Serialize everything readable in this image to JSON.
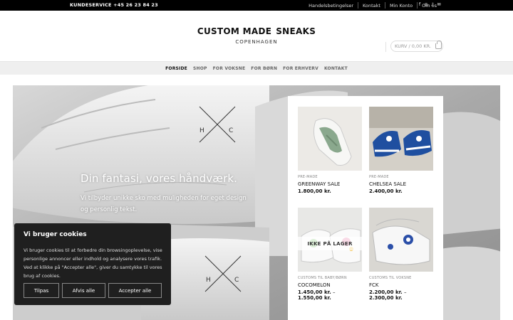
{
  "topbar": {
    "customer_service": "KUNDESERVICE +45 26 23 84 23",
    "links": [
      "Handelsbetingelser",
      "Kontakt",
      "Min Konto",
      "Om os"
    ],
    "socials": [
      "facebook-icon",
      "instagram-icon",
      "tiktok-icon",
      "email-icon"
    ]
  },
  "logo": {
    "line1_left": "CUSTOM MADE",
    "line1_right": "SNEAKS",
    "line2": "COPENHAGEN"
  },
  "cart": {
    "label": "KURV / 0,00 KR."
  },
  "nav": {
    "items": [
      "FORSIDE",
      "SHOP",
      "FOR VOKSNE",
      "FOR BØRN",
      "FOR ERHVERV",
      "KONTAKT"
    ],
    "active": "FORSIDE"
  },
  "hero": {
    "title": "Din fantasi, vores håndværk.",
    "text": "Vi tilbyder unikke sko med muligheden for eget design og personlig tekst."
  },
  "products": [
    {
      "category": "PRE-MADE",
      "name": "GREENWAY SALE",
      "price": "1.800,00 kr."
    },
    {
      "category": "PRE-MADE",
      "name": "CHELSEA SALE",
      "price": "2.400,00 kr."
    },
    {
      "category": "CUSTOMS TIL BABY/BØRN",
      "name": "COCOMELON",
      "price_from": "1.450,00 kr.",
      "price_to": "1.550,00 kr.",
      "badge": "IKKE PÅ LAGER"
    },
    {
      "category": "CUSTOMS TIL VOKSNE",
      "name": "FCK",
      "price_from": "2.200,00 kr.",
      "price_to": "2.300,00 kr."
    }
  ],
  "cookie": {
    "title": "Vi bruger cookies",
    "body": "Vi bruger cookies til at forbedre din browsingoplevelse, vise personlige annoncer eller indhold og analysere vores trafik. Ved at klikke på \"Accepter alle\", giver du samtykke til vores brug af cookies.",
    "buttons": [
      "Tilpas",
      "Afvis alle",
      "Accepter alle"
    ]
  },
  "colors": {
    "topbar": "#000000",
    "nav_bg": "#efefef",
    "cookie_bg": "#1f1f1f"
  }
}
